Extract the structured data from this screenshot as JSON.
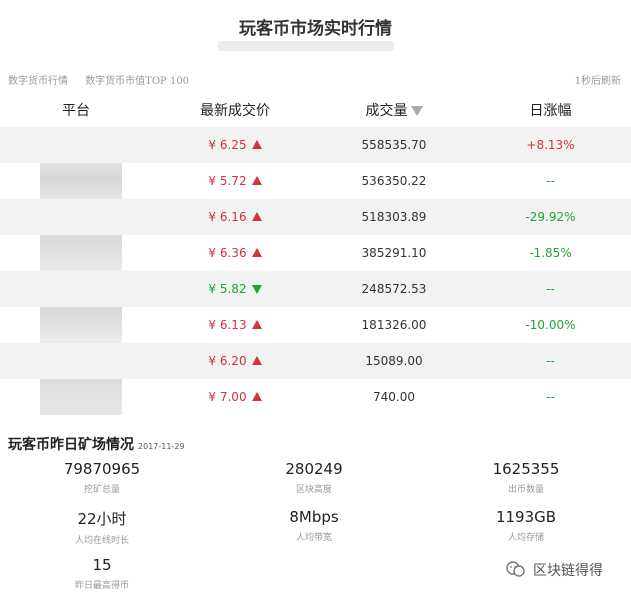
{
  "page": {
    "title": "玩客币市场实时行情"
  },
  "tabs": [
    "数字货币行情",
    "数字货币市值TOP 100"
  ],
  "refresh_text": "1秒后刷新",
  "table": {
    "headers": {
      "platform": "平台",
      "price": "最新成交价",
      "volume": "成交量",
      "change": "日涨幅"
    },
    "rows": [
      {
        "price": "¥ 6.25",
        "direction": "up",
        "volume": "558535.70",
        "change": "+8.13%"
      },
      {
        "price": "¥ 5.72",
        "direction": "up",
        "volume": "536350.22",
        "change": "--"
      },
      {
        "price": "¥ 6.16",
        "direction": "up",
        "volume": "518303.89",
        "change": "-29.92%"
      },
      {
        "price": "¥ 6.36",
        "direction": "up",
        "volume": "385291.10",
        "change": "-1.85%"
      },
      {
        "price": "¥ 5.82",
        "direction": "down",
        "volume": "248572.53",
        "change": "--"
      },
      {
        "price": "¥ 6.13",
        "direction": "up",
        "volume": "181326.00",
        "change": "-10.00%"
      },
      {
        "price": "¥ 6.20",
        "direction": "up",
        "volume": "15089.00",
        "change": "--"
      },
      {
        "price": "¥ 7.00",
        "direction": "up",
        "volume": "740.00",
        "change": "--"
      }
    ]
  },
  "mining": {
    "title": "玩客币昨日矿场情况",
    "date": "2017-11-29",
    "stats": [
      {
        "value": "79870965",
        "label": "挖矿总量"
      },
      {
        "value": "280249",
        "label": "区块高度"
      },
      {
        "value": "1625355",
        "label": "出币数量"
      },
      {
        "value": "22小时",
        "label": "人均在线时长"
      },
      {
        "value": "8Mbps",
        "label": "人均带宽"
      },
      {
        "value": "1193GB",
        "label": "人均存储"
      },
      {
        "value": "15",
        "label": "昨日最高得币"
      }
    ]
  },
  "watermark": {
    "text": "区块链得得"
  },
  "colors": {
    "up": "#d0343c",
    "down": "#22a534",
    "row_shade": "#f2f2f2"
  }
}
